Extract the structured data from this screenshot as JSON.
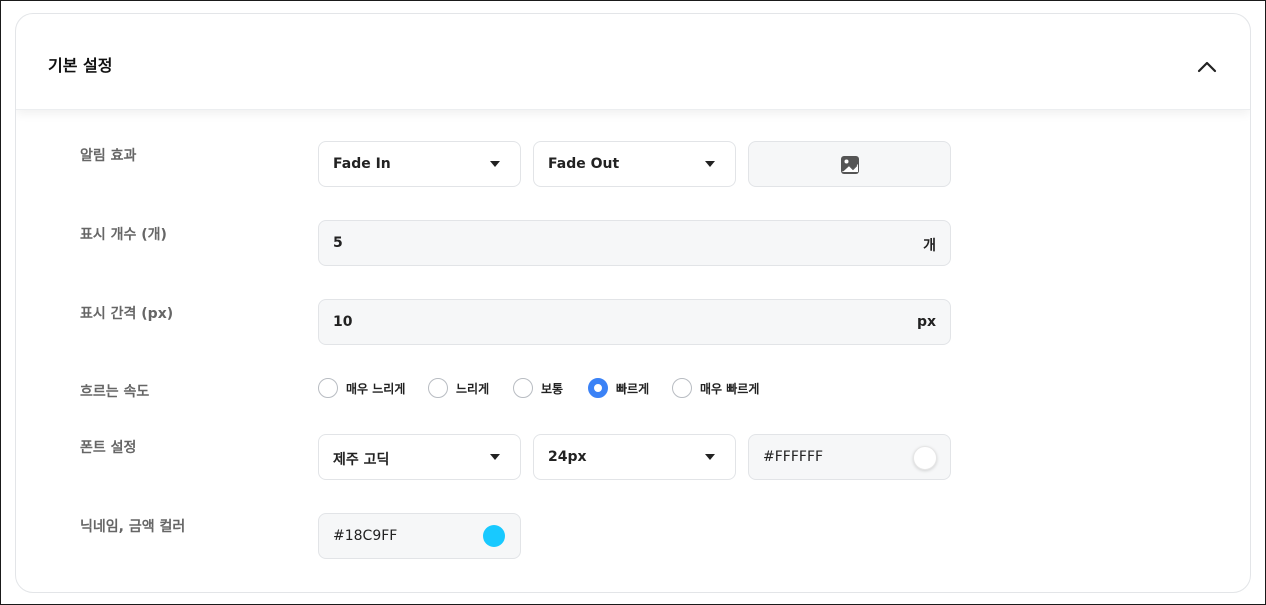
{
  "panel": {
    "title": "기본 설정"
  },
  "rows": {
    "effect": {
      "label": "알림 효과",
      "fade_in": "Fade In",
      "fade_out": "Fade Out",
      "image_icon": "image-icon"
    },
    "count": {
      "label": "표시 개수 (개)",
      "value": "5",
      "unit": "개"
    },
    "gap": {
      "label": "표시 간격 (px)",
      "value": "10",
      "unit": "px"
    },
    "speed": {
      "label": "흐르는 속도",
      "options": [
        "매우 느리게",
        "느리게",
        "보통",
        "빠르게",
        "매우 빠르게"
      ],
      "selected": "빠르게"
    },
    "font": {
      "label": "폰트 설정",
      "family": "제주 고딕",
      "size": "24px",
      "color_text": "#FFFFFF",
      "color": "#FFFFFF"
    },
    "nickname": {
      "label": "닉네임, 금액 컬러",
      "color_text": "#18C9FF",
      "color": "#18C9FF"
    }
  },
  "colors": {
    "accent": "#3B82F6"
  }
}
